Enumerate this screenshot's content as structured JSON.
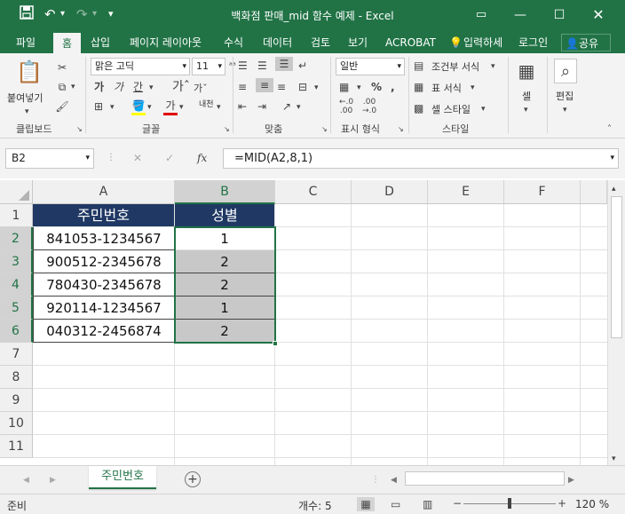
{
  "window": {
    "title": "백화점 판매_mid 함수 예제 - Excel",
    "qa_save_icon": "save-icon",
    "qa_undo_icon": "undo-icon",
    "qa_redo_icon": "redo-icon"
  },
  "tabs": [
    {
      "label": "파일"
    },
    {
      "label": "홈"
    },
    {
      "label": "삽입"
    },
    {
      "label": "페이지 레이아웃"
    },
    {
      "label": "수식"
    },
    {
      "label": "데이터"
    },
    {
      "label": "검토"
    },
    {
      "label": "보기"
    },
    {
      "label": "ACROBAT"
    },
    {
      "label": "입력하세"
    },
    {
      "label": "로그인"
    },
    {
      "label": "공유"
    }
  ],
  "ribbon": {
    "paste_label": "붙여넣기",
    "font_name": "맑은 고딕",
    "font_size": "11",
    "number_format": "일반",
    "cond_format": "조건부 서식",
    "table_format": "표 서식",
    "cell_style": "셀 스타일",
    "cells_label": "셀",
    "edit_label": "편집",
    "wrap_label": "내천",
    "groups": {
      "clipboard": "클립보드",
      "font": "글꼴",
      "align": "맞춤",
      "number": "표시 형식",
      "style": "스타일"
    }
  },
  "formula_bar": {
    "name_box": "B2",
    "formula": "=MID(A2,8,1)",
    "fx": "fx"
  },
  "grid": {
    "columns": [
      "A",
      "B",
      "C",
      "D",
      "E",
      "F"
    ],
    "rows": [
      "1",
      "2",
      "3",
      "4",
      "5",
      "6",
      "7",
      "8",
      "9",
      "10",
      "11"
    ],
    "header": {
      "a": "주민번호",
      "b": "성별"
    },
    "data": [
      {
        "a": "841053-1234567",
        "b": "1"
      },
      {
        "a": "900512-2345678",
        "b": "2"
      },
      {
        "a": "780430-2345678",
        "b": "2"
      },
      {
        "a": "920114-1234567",
        "b": "1"
      },
      {
        "a": "040312-2456874",
        "b": "2"
      }
    ]
  },
  "sheets": [
    {
      "name": "주민번호"
    }
  ],
  "status": {
    "ready": "준비",
    "count": "개수: 5",
    "zoom": "120 %"
  },
  "colors": {
    "accent": "#217346",
    "header_fill": "#203864",
    "selection_fill": "#c8c8c8"
  }
}
